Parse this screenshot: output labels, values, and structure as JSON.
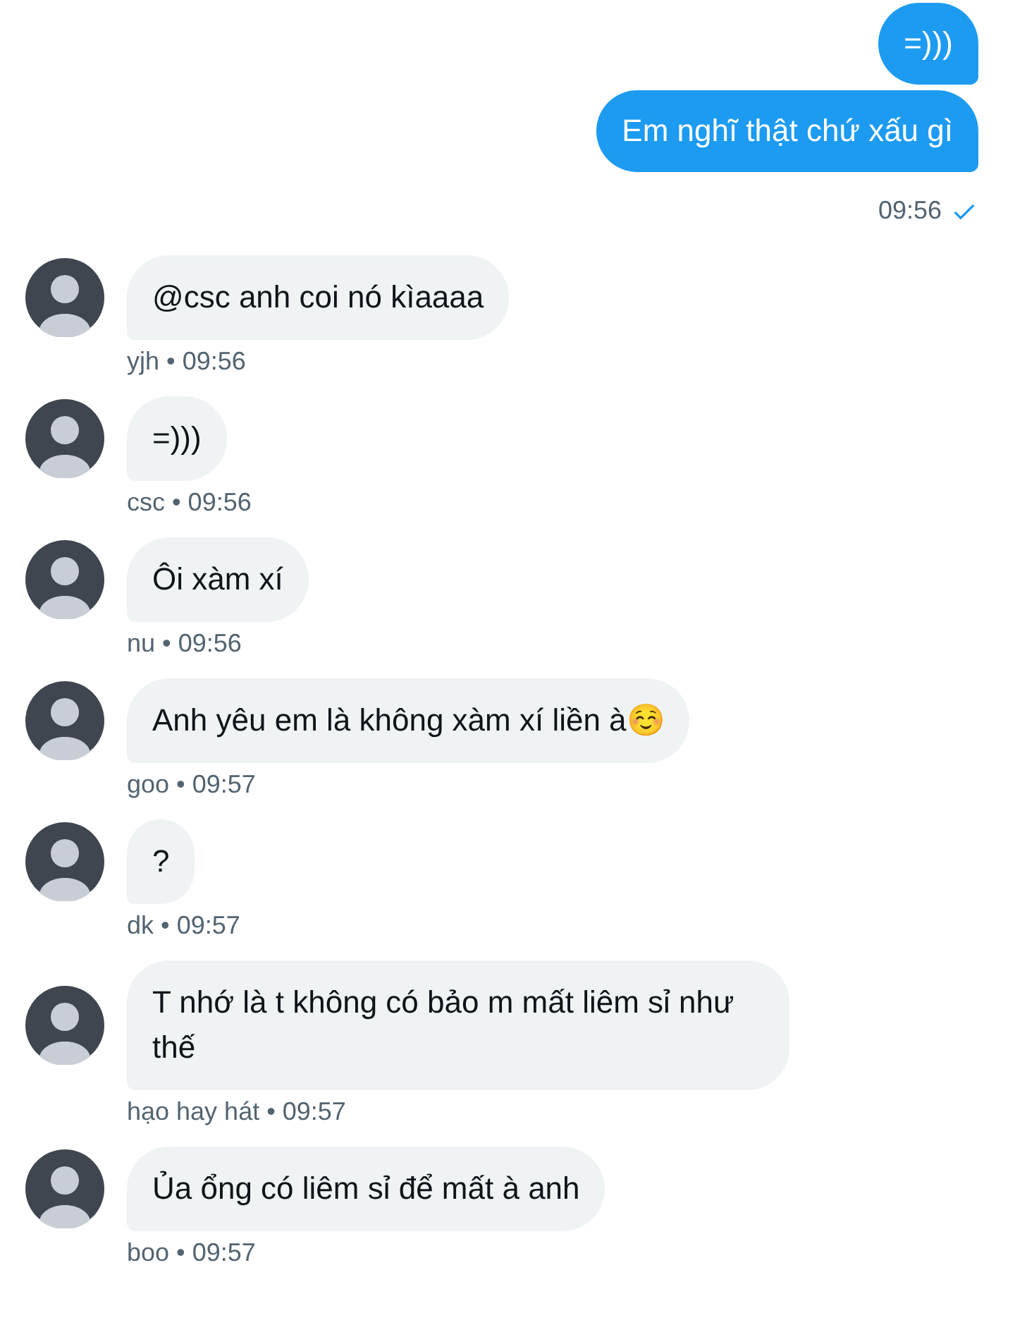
{
  "outgoing": {
    "messages": [
      "=)))",
      "Em nghĩ thật chứ xấu gì"
    ],
    "time": "09:56",
    "seen": true
  },
  "incoming": [
    {
      "text": "@csc anh coi nó kìaaaa",
      "meta": "yjh • 09:56"
    },
    {
      "text": "=)))",
      "meta": "csc • 09:56"
    },
    {
      "text": "Ôi xàm xí",
      "meta": "nu • 09:56"
    },
    {
      "text": "Anh yêu em là không xàm xí liền à☺️",
      "meta": "goo • 09:57"
    },
    {
      "text": "?",
      "meta": "dk • 09:57"
    },
    {
      "text": "T nhớ là t không có bảo m mất liêm sỉ như thế",
      "meta": "hạo hay hát • 09:57"
    },
    {
      "text": "Ủa ổng có liêm sỉ để mất à anh",
      "meta": "boo • 09:57"
    }
  ]
}
